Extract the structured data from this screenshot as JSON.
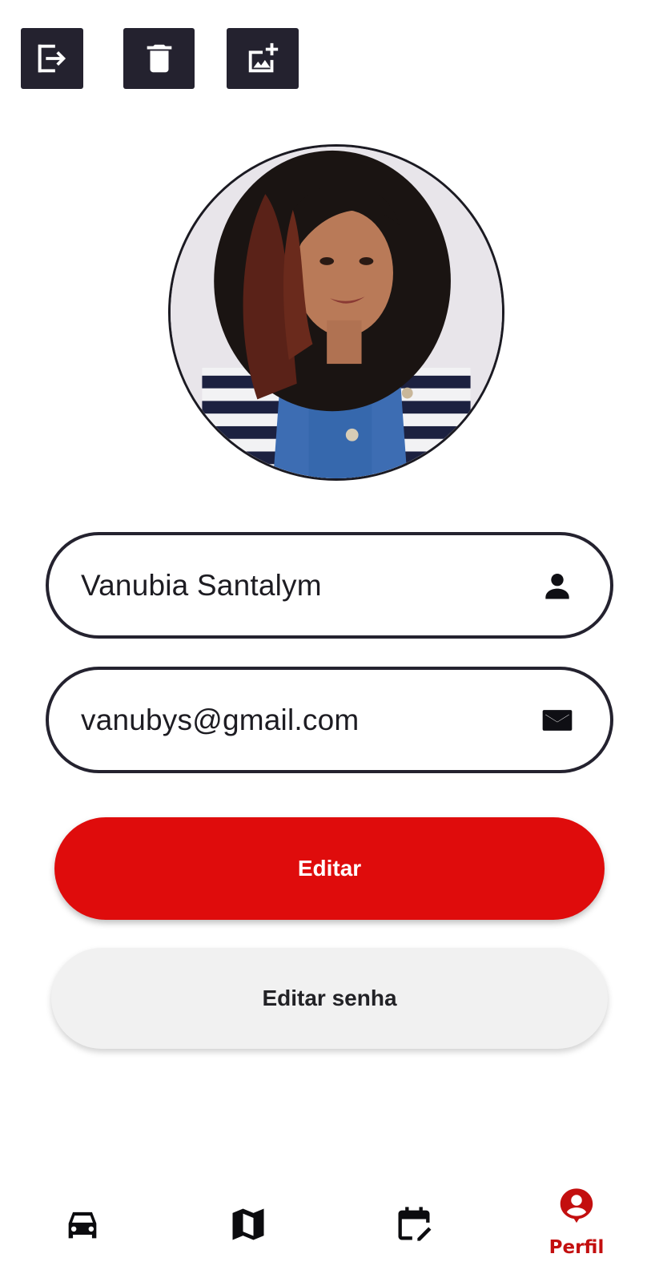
{
  "toolbar": {
    "logout_icon": "logout-icon",
    "delete_icon": "trash-icon",
    "add_photo_icon": "add-photo-icon"
  },
  "profile": {
    "photo": "profile-photo"
  },
  "form": {
    "name_value": "Vanubia Santalym",
    "name_icon": "person-icon",
    "email_value": "vanubys@gmail.com",
    "email_icon": "mail-icon"
  },
  "actions": {
    "edit_label": "Editar",
    "edit_password_label": "Editar senha"
  },
  "bottom_nav": {
    "items": [
      {
        "icon": "car-icon",
        "label": ""
      },
      {
        "icon": "map-icon",
        "label": ""
      },
      {
        "icon": "calendar-edit-icon",
        "label": ""
      },
      {
        "icon": "profile-pin-icon",
        "label": "Perfil"
      }
    ],
    "active_index": 3
  },
  "colors": {
    "toolbar_bg": "#24222f",
    "primary_red": "#df0c0c",
    "active_nav": "#c30f0f",
    "secondary_btn_bg": "#f1f1f1"
  }
}
